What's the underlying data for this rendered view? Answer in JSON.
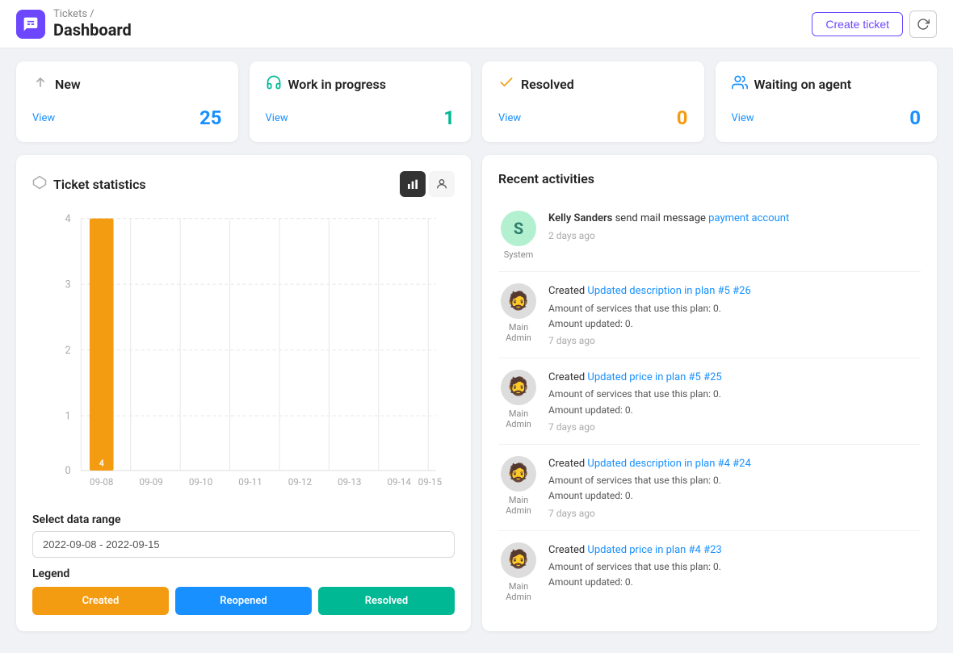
{
  "header": {
    "breadcrumb": "Tickets /",
    "title": "Dashboard",
    "create_ticket_label": "Create ticket",
    "refresh_icon": "refresh"
  },
  "status_cards": [
    {
      "id": "new",
      "title": "New",
      "icon": "arrow-up-icon",
      "view_label": "View",
      "count": "25",
      "count_color": "#1890ff"
    },
    {
      "id": "wip",
      "title": "Work in progress",
      "icon": "headset-icon",
      "view_label": "View",
      "count": "1",
      "count_color": "#00b894"
    },
    {
      "id": "resolved",
      "title": "Resolved",
      "icon": "check-icon",
      "view_label": "View",
      "count": "0",
      "count_color": "#f39c12"
    },
    {
      "id": "waiting",
      "title": "Waiting on agent",
      "icon": "person-icon",
      "view_label": "View",
      "count": "0",
      "count_color": "#1890ff"
    }
  ],
  "ticket_statistics": {
    "title": "Ticket statistics",
    "date_range_label": "Select data range",
    "date_range_value": "2022-09-08 - 2022-09-15",
    "date_range_placeholder": "2022-09-08 - 2022-09-15",
    "legend_title": "Legend",
    "legend": [
      {
        "label": "Created",
        "color": "#f39c12"
      },
      {
        "label": "Reopened",
        "color": "#1890ff"
      },
      {
        "label": "Resolved",
        "color": "#00b894"
      }
    ],
    "chart": {
      "x_labels": [
        "09-08",
        "09-09",
        "09-10",
        "09-11",
        "09-12",
        "09-13",
        "09-14",
        "09-15"
      ],
      "y_max": 4,
      "bars": [
        {
          "date": "09-08",
          "created": 4,
          "reopened": 0,
          "resolved": 0
        },
        {
          "date": "09-09",
          "created": 0,
          "reopened": 0,
          "resolved": 0
        },
        {
          "date": "09-10",
          "created": 0,
          "reopened": 0,
          "resolved": 0
        },
        {
          "date": "09-11",
          "created": 0,
          "reopened": 0,
          "resolved": 0
        },
        {
          "date": "09-12",
          "created": 0,
          "reopened": 0,
          "resolved": 0
        },
        {
          "date": "09-13",
          "created": 0,
          "reopened": 0,
          "resolved": 0
        },
        {
          "date": "09-14",
          "created": 0,
          "reopened": 0,
          "resolved": 0
        },
        {
          "date": "09-15",
          "created": 0,
          "reopened": 0,
          "resolved": 0
        }
      ]
    }
  },
  "recent_activities": {
    "title": "Recent activities",
    "items": [
      {
        "id": 1,
        "avatar_type": "initial",
        "avatar_initial": "S",
        "avatar_bg": "#b2f0d0",
        "avatar_color": "#2e7d6b",
        "label": "System",
        "text_prefix": "Kelly Sanders send mail message",
        "link_text": "payment account",
        "text_suffix": "",
        "sub_lines": [],
        "time": "2 days ago"
      },
      {
        "id": 2,
        "avatar_type": "emoji",
        "avatar_emoji": "🧔",
        "label": "Main\nAdmin",
        "text_prefix": "Created",
        "link_text": "Updated description in plan #5 #26",
        "text_suffix": "",
        "sub_lines": [
          "Amount of services that use this plan: 0.",
          "Amount updated: 0."
        ],
        "time": "7 days ago"
      },
      {
        "id": 3,
        "avatar_type": "emoji",
        "avatar_emoji": "🧔",
        "label": "Main\nAdmin",
        "text_prefix": "Created",
        "link_text": "Updated price in plan #5 #25",
        "text_suffix": "",
        "sub_lines": [
          "Amount of services that use this plan: 0.",
          "Amount updated: 0."
        ],
        "time": "7 days ago"
      },
      {
        "id": 4,
        "avatar_type": "emoji",
        "avatar_emoji": "🧔",
        "label": "Main\nAdmin",
        "text_prefix": "Created",
        "link_text": "Updated description in plan #4 #24",
        "text_suffix": "",
        "sub_lines": [
          "Amount of services that use this plan: 0.",
          "Amount updated: 0."
        ],
        "time": "7 days ago"
      },
      {
        "id": 5,
        "avatar_type": "emoji",
        "avatar_emoji": "🧔",
        "label": "Main\nAdmin",
        "text_prefix": "Created",
        "link_text": "Updated price in plan #4 #23",
        "text_suffix": "",
        "sub_lines": [
          "Amount of services that use this plan: 0.",
          "Amount updated: 0."
        ],
        "time": ""
      }
    ]
  }
}
